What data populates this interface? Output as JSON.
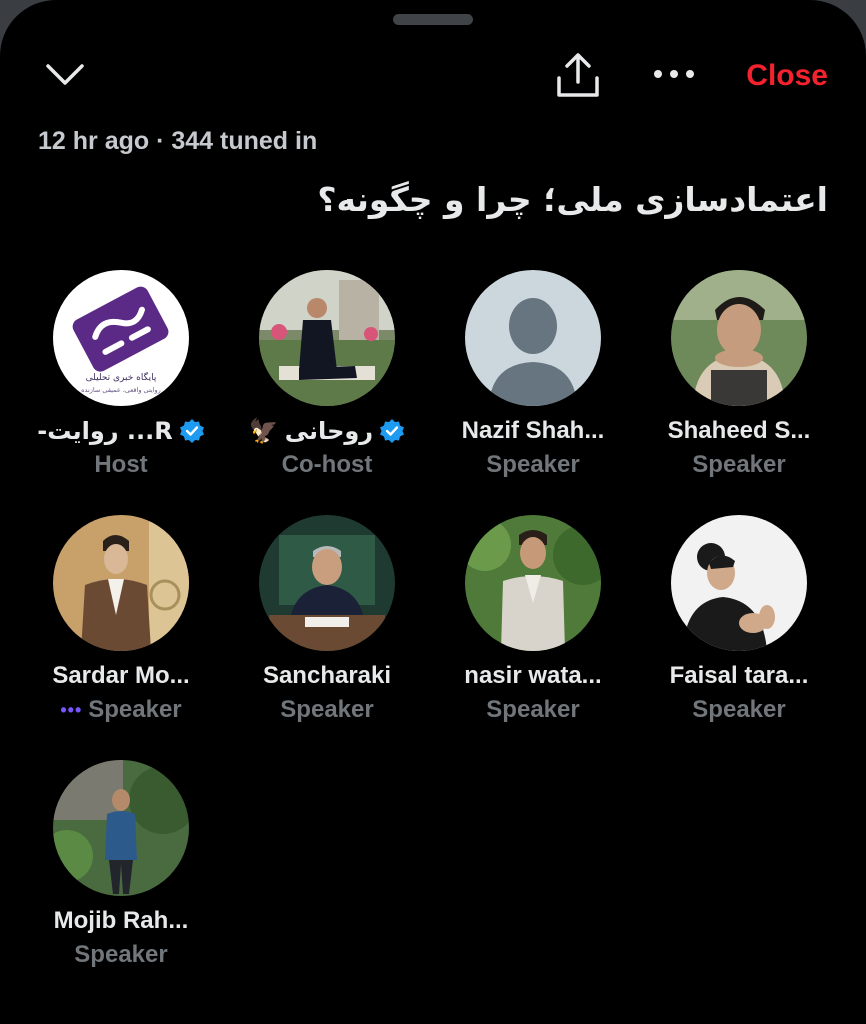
{
  "header": {
    "close_label": "Close",
    "meta": "12 hr ago · 344 tuned in",
    "title": "اعتمادسازی ملی؛ چرا و چگونه؟"
  },
  "icons": [
    "chevron-down-icon",
    "share-icon",
    "more-icon",
    "verified-icon",
    "eagle-emoji"
  ],
  "colors": {
    "close": "#f4212e",
    "verified": "#1d9bf0",
    "role": "#71767b",
    "speaking": "#7856ff"
  },
  "participants": [
    {
      "name": "R... روایت-",
      "role": "Host"
    },
    {
      "name": "روحانی",
      "emoji": "🦅",
      "role": "Co-host"
    },
    {
      "name": "Nazif Shah...",
      "role": "Speaker"
    },
    {
      "name": "Shaheed S...",
      "role": "Speaker"
    },
    {
      "name": "Sardar Mo...",
      "role": "Speaker",
      "speaking_dots": "•••"
    },
    {
      "name": "Sancharaki",
      "role": "Speaker"
    },
    {
      "name": "nasir wata...",
      "role": "Speaker"
    },
    {
      "name": "Faisal tara...",
      "role": "Speaker"
    },
    {
      "name": "Mojib Rah...",
      "role": "Speaker"
    }
  ],
  "logo": {
    "line1": "پایگاه خبری تحلیلی",
    "line2": "روایتی واقعی، عمیقی سازنده"
  }
}
